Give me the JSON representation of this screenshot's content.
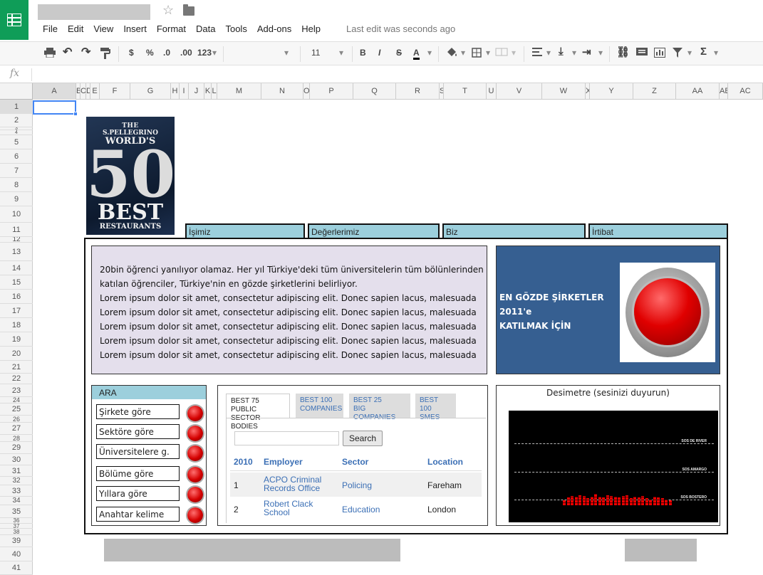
{
  "app": {
    "title": "",
    "menu": [
      "File",
      "Edit",
      "View",
      "Insert",
      "Format",
      "Data",
      "Tools",
      "Add-ons",
      "Help"
    ],
    "last_edit": "Last edit was seconds ago"
  },
  "toolbar": {
    "currency": "$",
    "percent": "%",
    "decrease_decimals": ".0",
    "increase_decimals": ".00",
    "number_format": "123",
    "font_size": "11",
    "bold": "B",
    "italic": "I",
    "strike": "S",
    "text_color": "A"
  },
  "formula_bar": {
    "fx": "fx",
    "value": ""
  },
  "columns": [
    "A",
    "B",
    "C",
    "D",
    "E",
    "F",
    "G",
    "H",
    "I",
    "J",
    "K",
    "L",
    "M",
    "N",
    "O",
    "P",
    "Q",
    "R",
    "S",
    "T",
    "U",
    "V",
    "W",
    "X",
    "Y",
    "Z",
    "AA",
    "AB",
    "AC"
  ],
  "rows": [
    "1",
    "2",
    "3",
    "4",
    "5",
    "6",
    "7",
    "8",
    "9",
    "10",
    "11",
    "12",
    "13",
    "14",
    "15",
    "16",
    "17",
    "18",
    "19",
    "20",
    "21",
    "22",
    "23",
    "24",
    "25",
    "26",
    "27",
    "28",
    "29",
    "30",
    "31",
    "32",
    "33",
    "34",
    "35",
    "36",
    "37",
    "38",
    "39",
    "40",
    "41"
  ],
  "logo": {
    "line1": "THE",
    "line2": "S.PELLEGRINO",
    "line3": "WORLD'S",
    "number": "50",
    "best": "BEST",
    "restaurants": "RESTAURANTS"
  },
  "nav_tabs": [
    "İşimiz",
    "Değerlerimiz",
    "Biz",
    "İrtibat"
  ],
  "intro": {
    "lines": [
      "20bin öğrenci yanılıyor olamaz. Her yıl Türkiye'deki tüm üniversitelerin tüm bölünlerinden",
      "katılan öğrenciler, Türkiye'nin en gözde şirketlerini belirliyor.",
      "Lorem ipsum dolor sit amet, consectetur adipiscing elit. Donec sapien lacus, malesuada",
      "Lorem ipsum dolor sit amet, consectetur adipiscing elit. Donec sapien lacus, malesuada",
      "Lorem ipsum dolor sit amet, consectetur adipiscing elit. Donec sapien lacus, malesuada",
      "Lorem ipsum dolor sit amet, consectetur adipiscing elit. Donec sapien lacus, malesuada",
      "Lorem ipsum dolor sit amet, consectetur adipiscing elit. Donec sapien lacus, malesuada"
    ]
  },
  "promo": {
    "line1": "EN GÖZDE ŞİRKETLER 2011'e",
    "line2": "KATILMAK İÇİN"
  },
  "search_panel": {
    "title": "ARA",
    "options": [
      "Şirkete göre",
      "Sektöre göre",
      "Üniversitelere g.",
      "Bölüme göre",
      "Yıllara göre",
      "Anahtar kelime"
    ]
  },
  "ranking": {
    "tabs": [
      {
        "line1": "BEST 75 PUBLIC",
        "line2": "SECTOR BODIES"
      },
      {
        "line1": "BEST 100",
        "line2": "COMPANIES"
      },
      {
        "line1": "BEST 25",
        "line2": "BIG COMPANIES"
      },
      {
        "line1": "BEST 100",
        "line2": "SMES"
      }
    ],
    "search_button": "Search",
    "headers": [
      "2010",
      "Employer",
      "Sector",
      "Location"
    ],
    "rows": [
      {
        "rank": "1",
        "employer_1": "ACPO Criminal",
        "employer_2": "Records Office",
        "sector": "Policing",
        "location": "Fareham"
      },
      {
        "rank": "2",
        "employer_1": "Robert Clack",
        "employer_2": "School",
        "sector": "Education",
        "location": "London"
      }
    ]
  },
  "meter": {
    "title": "Desimetre (sesinizi duyurun)",
    "labels": [
      "SOS DE RIVER",
      "SOS AMARGO",
      "SOS BOSTERO"
    ],
    "levels": [
      0.3,
      0.45,
      0.55,
      0.5,
      0.6,
      0.55,
      0.4,
      0.5,
      0.65,
      0.5,
      0.45,
      0.6,
      0.55,
      0.5,
      0.45,
      0.55,
      0.6,
      0.4,
      0.5,
      0.45,
      0.55,
      0.4,
      0.35,
      0.5,
      0.45,
      0.4,
      0.35,
      0.3
    ]
  },
  "colors": {
    "sheets_green": "#0f9d58",
    "tab_blue": "#9ccfdc",
    "promo_blue": "#365f91",
    "intro_lavender": "#e4dfec",
    "selection": "#4285f4"
  }
}
